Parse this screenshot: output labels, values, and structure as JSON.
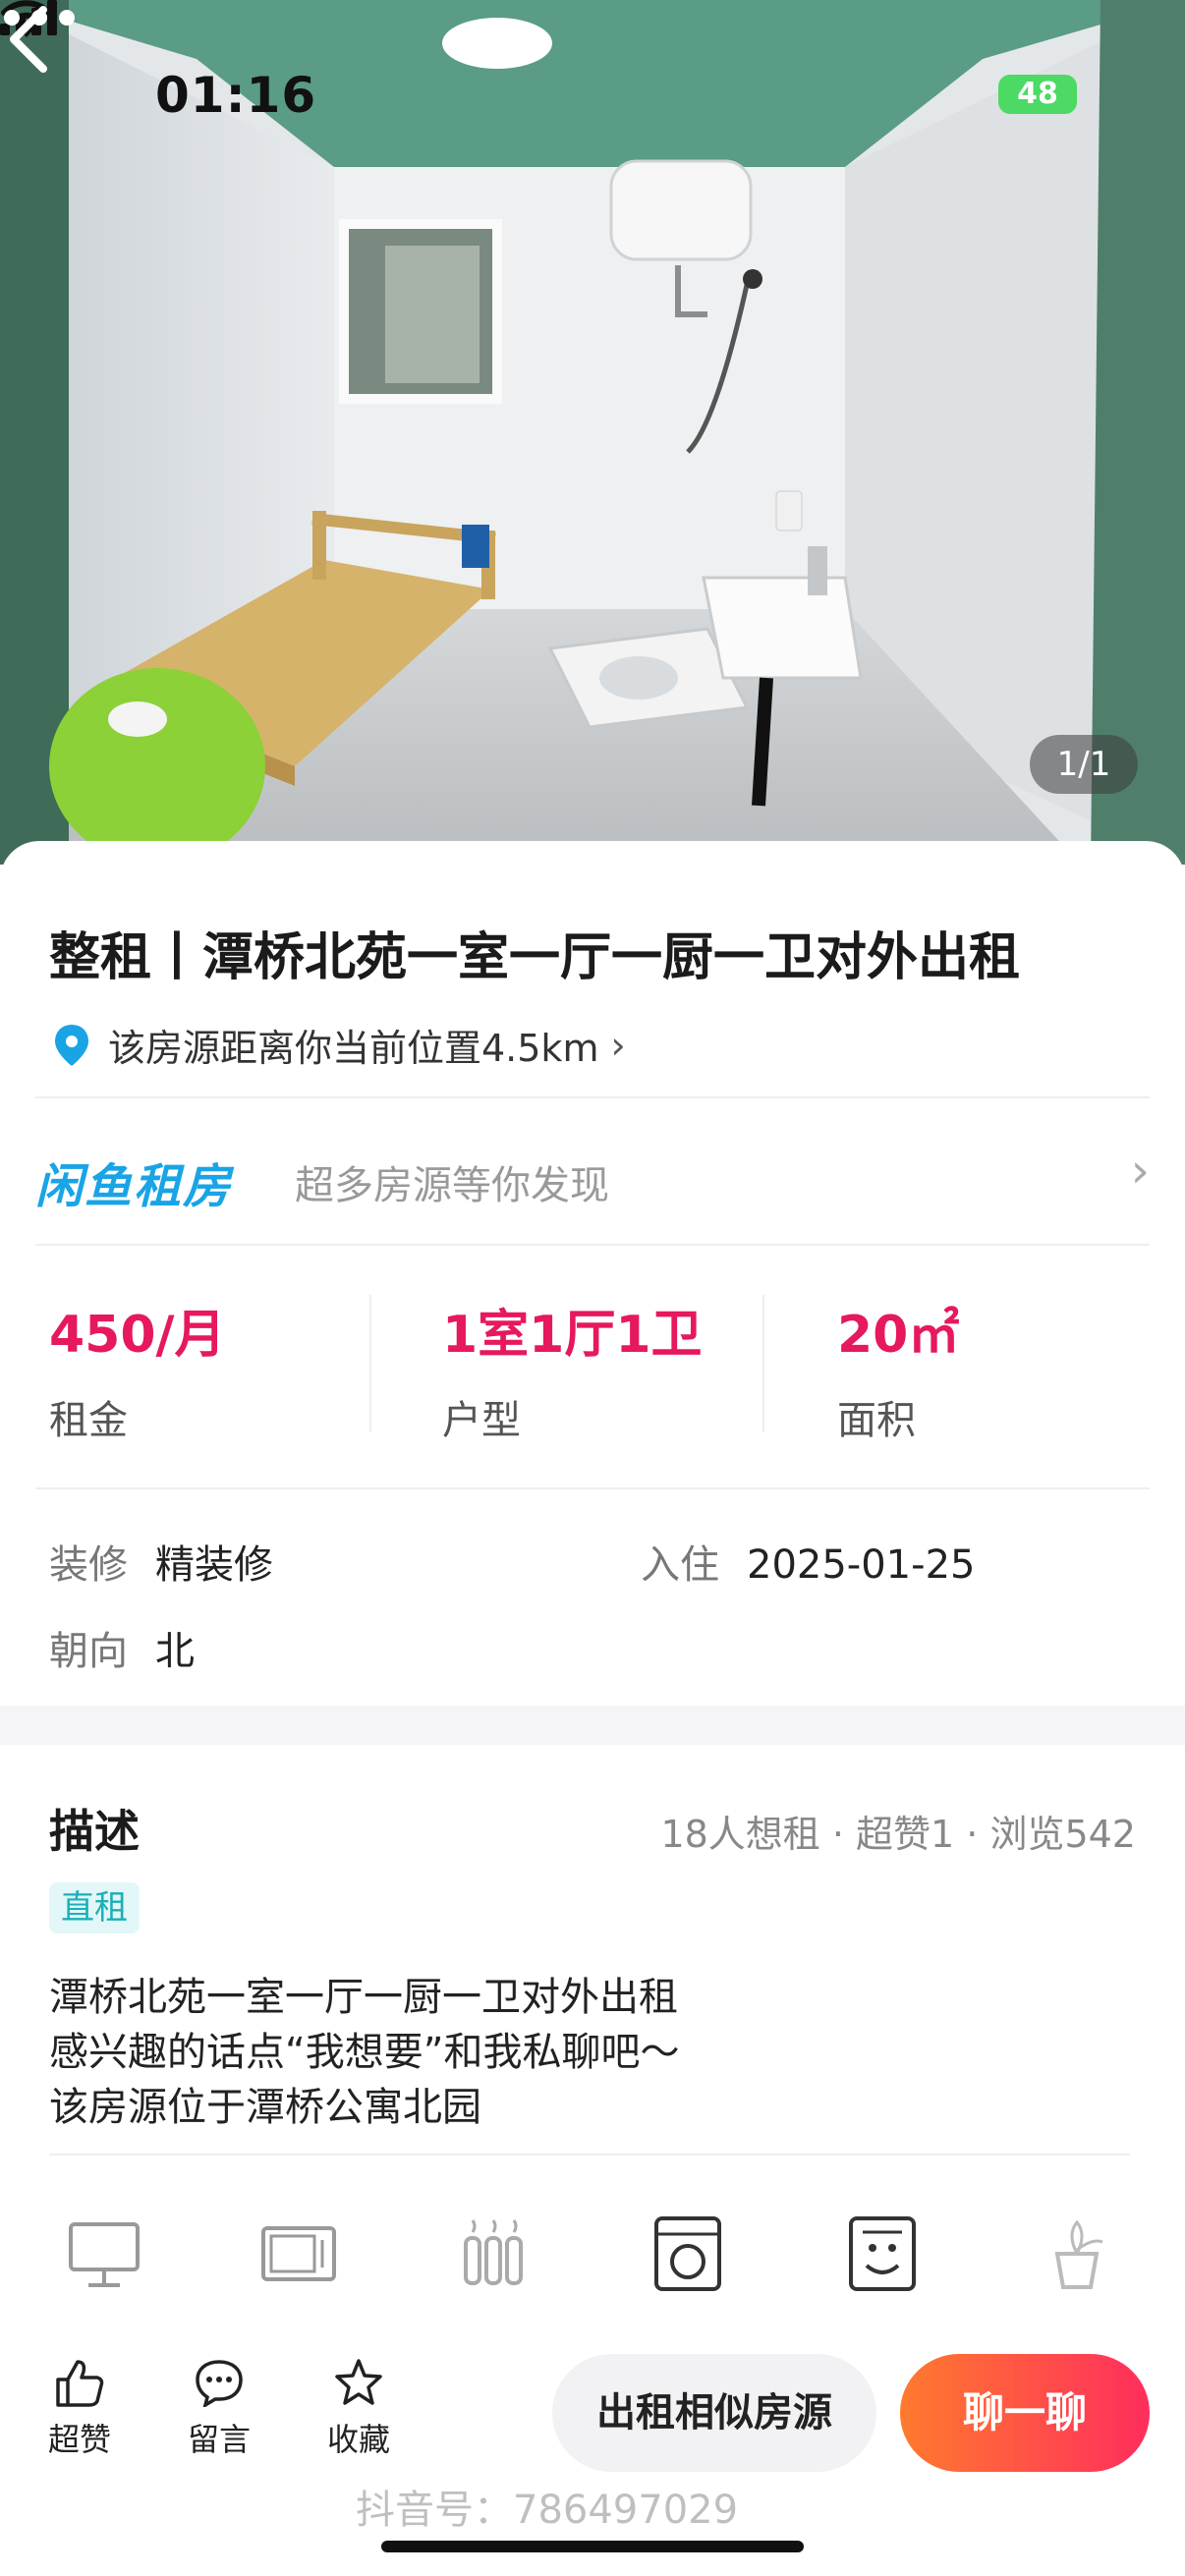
{
  "status_bar": {
    "time": "01:16",
    "battery": "48"
  },
  "photo": {
    "counter": "1/1"
  },
  "listing": {
    "title": "整租丨潭桥北苑一室一厅一厨一卫对外出租",
    "location_text": "该房源距离你当前位置4.5km"
  },
  "banner": {
    "brand": "闲鱼租房",
    "subtitle": "超多房源等你发现"
  },
  "stats": [
    {
      "value": "450/月",
      "label": "租金"
    },
    {
      "value": "1室1厅1卫",
      "label": "户型"
    },
    {
      "value": "20㎡",
      "label": "面积"
    }
  ],
  "details": {
    "decoration_label": "装修",
    "decoration_value": "精装修",
    "movein_label": "入住",
    "movein_value": "2025-01-25",
    "orientation_label": "朝向",
    "orientation_value": "北"
  },
  "description": {
    "title": "描述",
    "meta": "18人想租 · 超赞1 · 浏览542",
    "tag": "直租",
    "lines": [
      "潭桥北苑一室一厅一厨一卫对外出租",
      "感兴趣的话点“我想要”和我私聊吧～",
      "该房源位于潭桥公寓北园"
    ]
  },
  "amenities": [
    "tv-icon",
    "microwave-icon",
    "heater-icon",
    "washing-machine-icon",
    "range-hood-icon",
    "plant-icon"
  ],
  "bottom_bar": {
    "like_label": "超赞",
    "comment_label": "留言",
    "favorite_label": "收藏",
    "similar_button": "出租相似房源",
    "chat_button": "聊一聊"
  },
  "watermark": "抖音号：786497029",
  "colors": {
    "accent": "#e6185e",
    "brand": "#19a4e6",
    "chat_start": "#ff7a2e",
    "chat_end": "#ff2d5d"
  }
}
